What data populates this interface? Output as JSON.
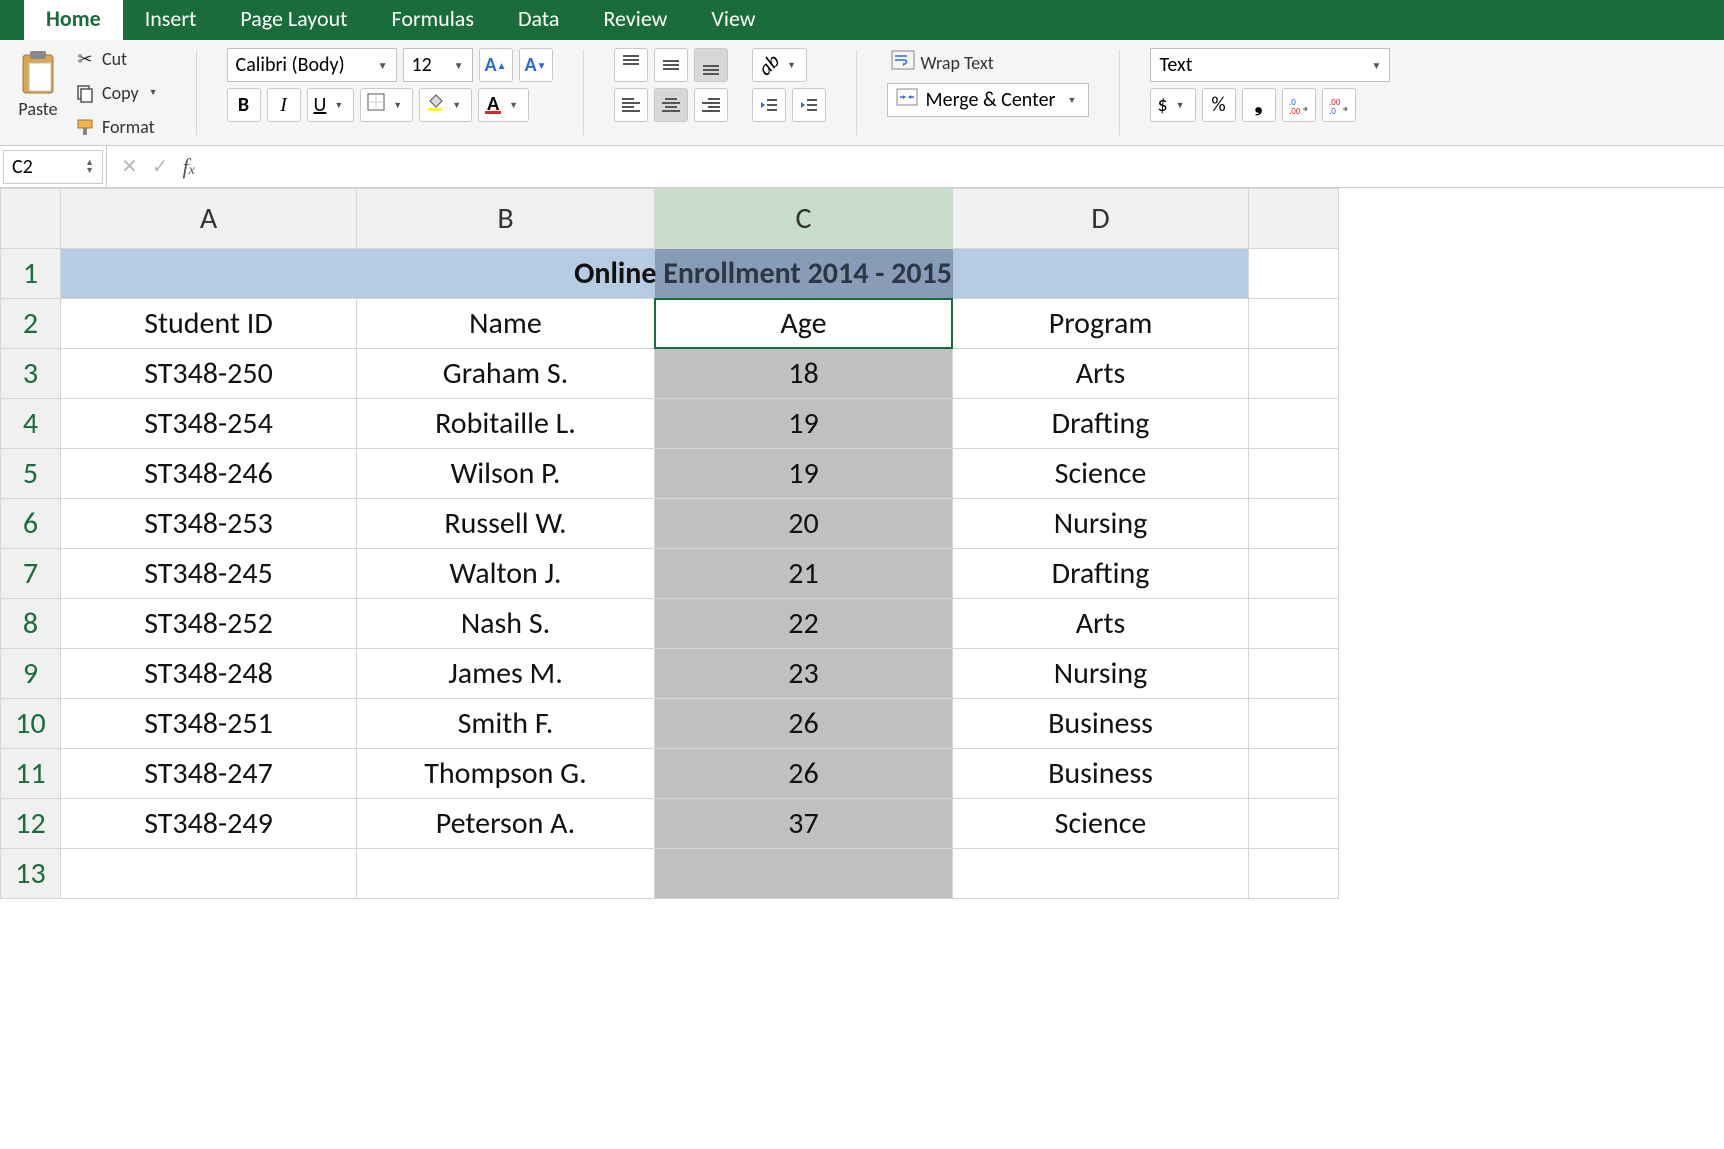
{
  "ribbon": {
    "tabs": [
      "Home",
      "Insert",
      "Page Layout",
      "Formulas",
      "Data",
      "Review",
      "View"
    ],
    "paste": "Paste",
    "cut": "Cut",
    "copy": "Copy",
    "format": "Format",
    "font": "Calibri (Body)",
    "size": "12",
    "wrap": "Wrap Text",
    "merge": "Merge & Center",
    "number_format": "Text",
    "currency": "$",
    "percent": "%"
  },
  "formula": {
    "cell_ref": "C2",
    "value": ""
  },
  "columns": [
    "A",
    "B",
    "C",
    "D"
  ],
  "rows": [
    "1",
    "2",
    "3",
    "4",
    "5",
    "6",
    "7",
    "8",
    "9",
    "10",
    "11",
    "12",
    "13"
  ],
  "data": {
    "title": "Online Enrollment 2014 - 2015",
    "headers": [
      "Student ID",
      "Name",
      "Age",
      "Program"
    ],
    "rows": [
      {
        "id": "ST348-250",
        "name": "Graham S.",
        "age": "18",
        "program": "Arts"
      },
      {
        "id": "ST348-254",
        "name": "Robitaille L.",
        "age": "19",
        "program": "Drafting"
      },
      {
        "id": "ST348-246",
        "name": "Wilson P.",
        "age": "19",
        "program": "Science"
      },
      {
        "id": "ST348-253",
        "name": "Russell W.",
        "age": "20",
        "program": "Nursing"
      },
      {
        "id": "ST348-245",
        "name": "Walton J.",
        "age": "21",
        "program": "Drafting"
      },
      {
        "id": "ST348-252",
        "name": "Nash S.",
        "age": "22",
        "program": "Arts"
      },
      {
        "id": "ST348-248",
        "name": "James M.",
        "age": "23",
        "program": "Nursing"
      },
      {
        "id": "ST348-251",
        "name": "Smith F.",
        "age": "26",
        "program": "Business"
      },
      {
        "id": "ST348-247",
        "name": "Thompson G.",
        "age": "26",
        "program": "Business"
      },
      {
        "id": "ST348-249",
        "name": "Peterson A.",
        "age": "37",
        "program": "Science"
      }
    ]
  }
}
